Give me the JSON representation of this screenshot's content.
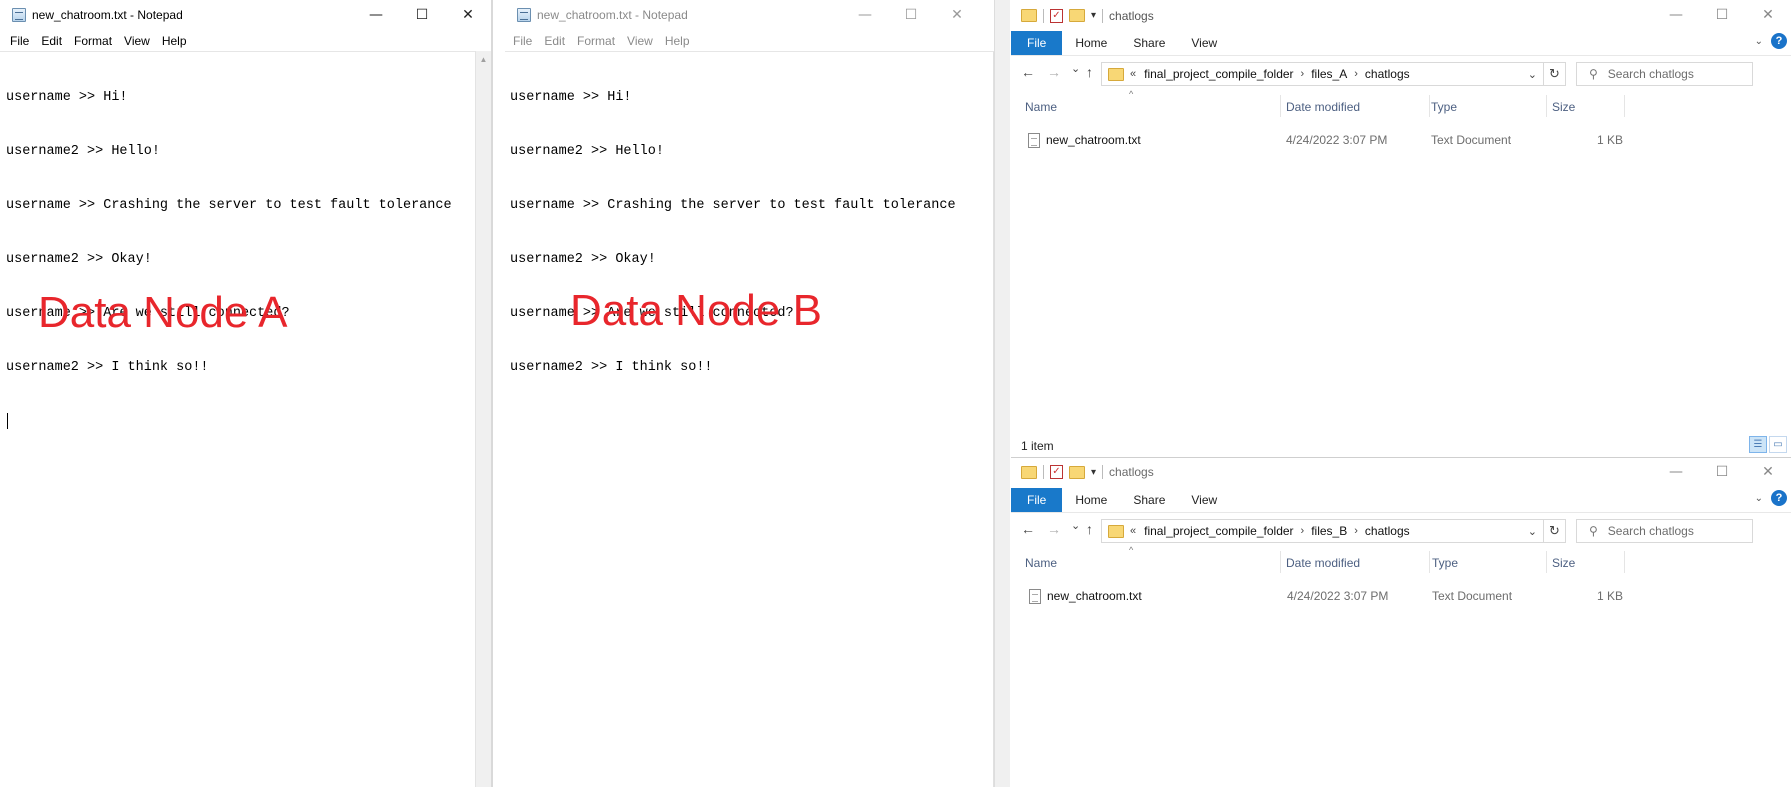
{
  "notepad_a": {
    "title": "new_chatroom.txt - Notepad",
    "menu": [
      "File",
      "Edit",
      "Format",
      "View",
      "Help"
    ],
    "lines": [
      "username >> Hi!",
      "username2 >> Hello!",
      "username >> Crashing the server to test fault tolerance",
      "username2 >> Okay!",
      "username >> Are we still connected?",
      "username2 >> I think so!!"
    ],
    "overlay_label": "Data Node A"
  },
  "notepad_b": {
    "title": "new_chatroom.txt - Notepad",
    "menu": [
      "File",
      "Edit",
      "Format",
      "View",
      "Help"
    ],
    "lines": [
      "username >> Hi!",
      "username2 >> Hello!",
      "username >> Crashing the server to test fault tolerance",
      "username2 >> Okay!",
      "username >> Are we still connected?",
      "username2 >> I think so!!"
    ],
    "overlay_label": "Data Node B"
  },
  "caption_buttons": {
    "minimize": "—",
    "maximize": "☐",
    "close": "✕"
  },
  "explorer_top": {
    "title": "chatlogs",
    "ribbon_tabs": [
      "File",
      "Home",
      "Share",
      "View"
    ],
    "breadcrumb": [
      "final_project_compile_folder",
      "files_A",
      "chatlogs"
    ],
    "search_placeholder": "Search chatlogs",
    "columns": [
      "Name",
      "Date modified",
      "Type",
      "Size"
    ],
    "files": [
      {
        "name": "new_chatroom.txt",
        "date": "4/24/2022 3:07 PM",
        "type": "Text Document",
        "size": "1 KB"
      }
    ],
    "status": "1 item"
  },
  "explorer_bottom": {
    "title": "chatlogs",
    "ribbon_tabs": [
      "File",
      "Home",
      "Share",
      "View"
    ],
    "breadcrumb": [
      "final_project_compile_folder",
      "files_B",
      "chatlogs"
    ],
    "search_placeholder": "Search chatlogs",
    "columns": [
      "Name",
      "Date modified",
      "Type",
      "Size"
    ],
    "files": [
      {
        "name": "new_chatroom.txt",
        "date": "4/24/2022 3:07 PM",
        "type": "Text Document",
        "size": "1 KB"
      }
    ]
  },
  "icons": {
    "back": "←",
    "forward": "→",
    "recent": "⌄",
    "up": "↑",
    "refresh": "↻",
    "search": "⚲",
    "overflow": "«",
    "crumb_sep": "›",
    "dropdown": "⌄",
    "help": "?",
    "ribbon_collapse": "⌄",
    "sort": "^"
  }
}
